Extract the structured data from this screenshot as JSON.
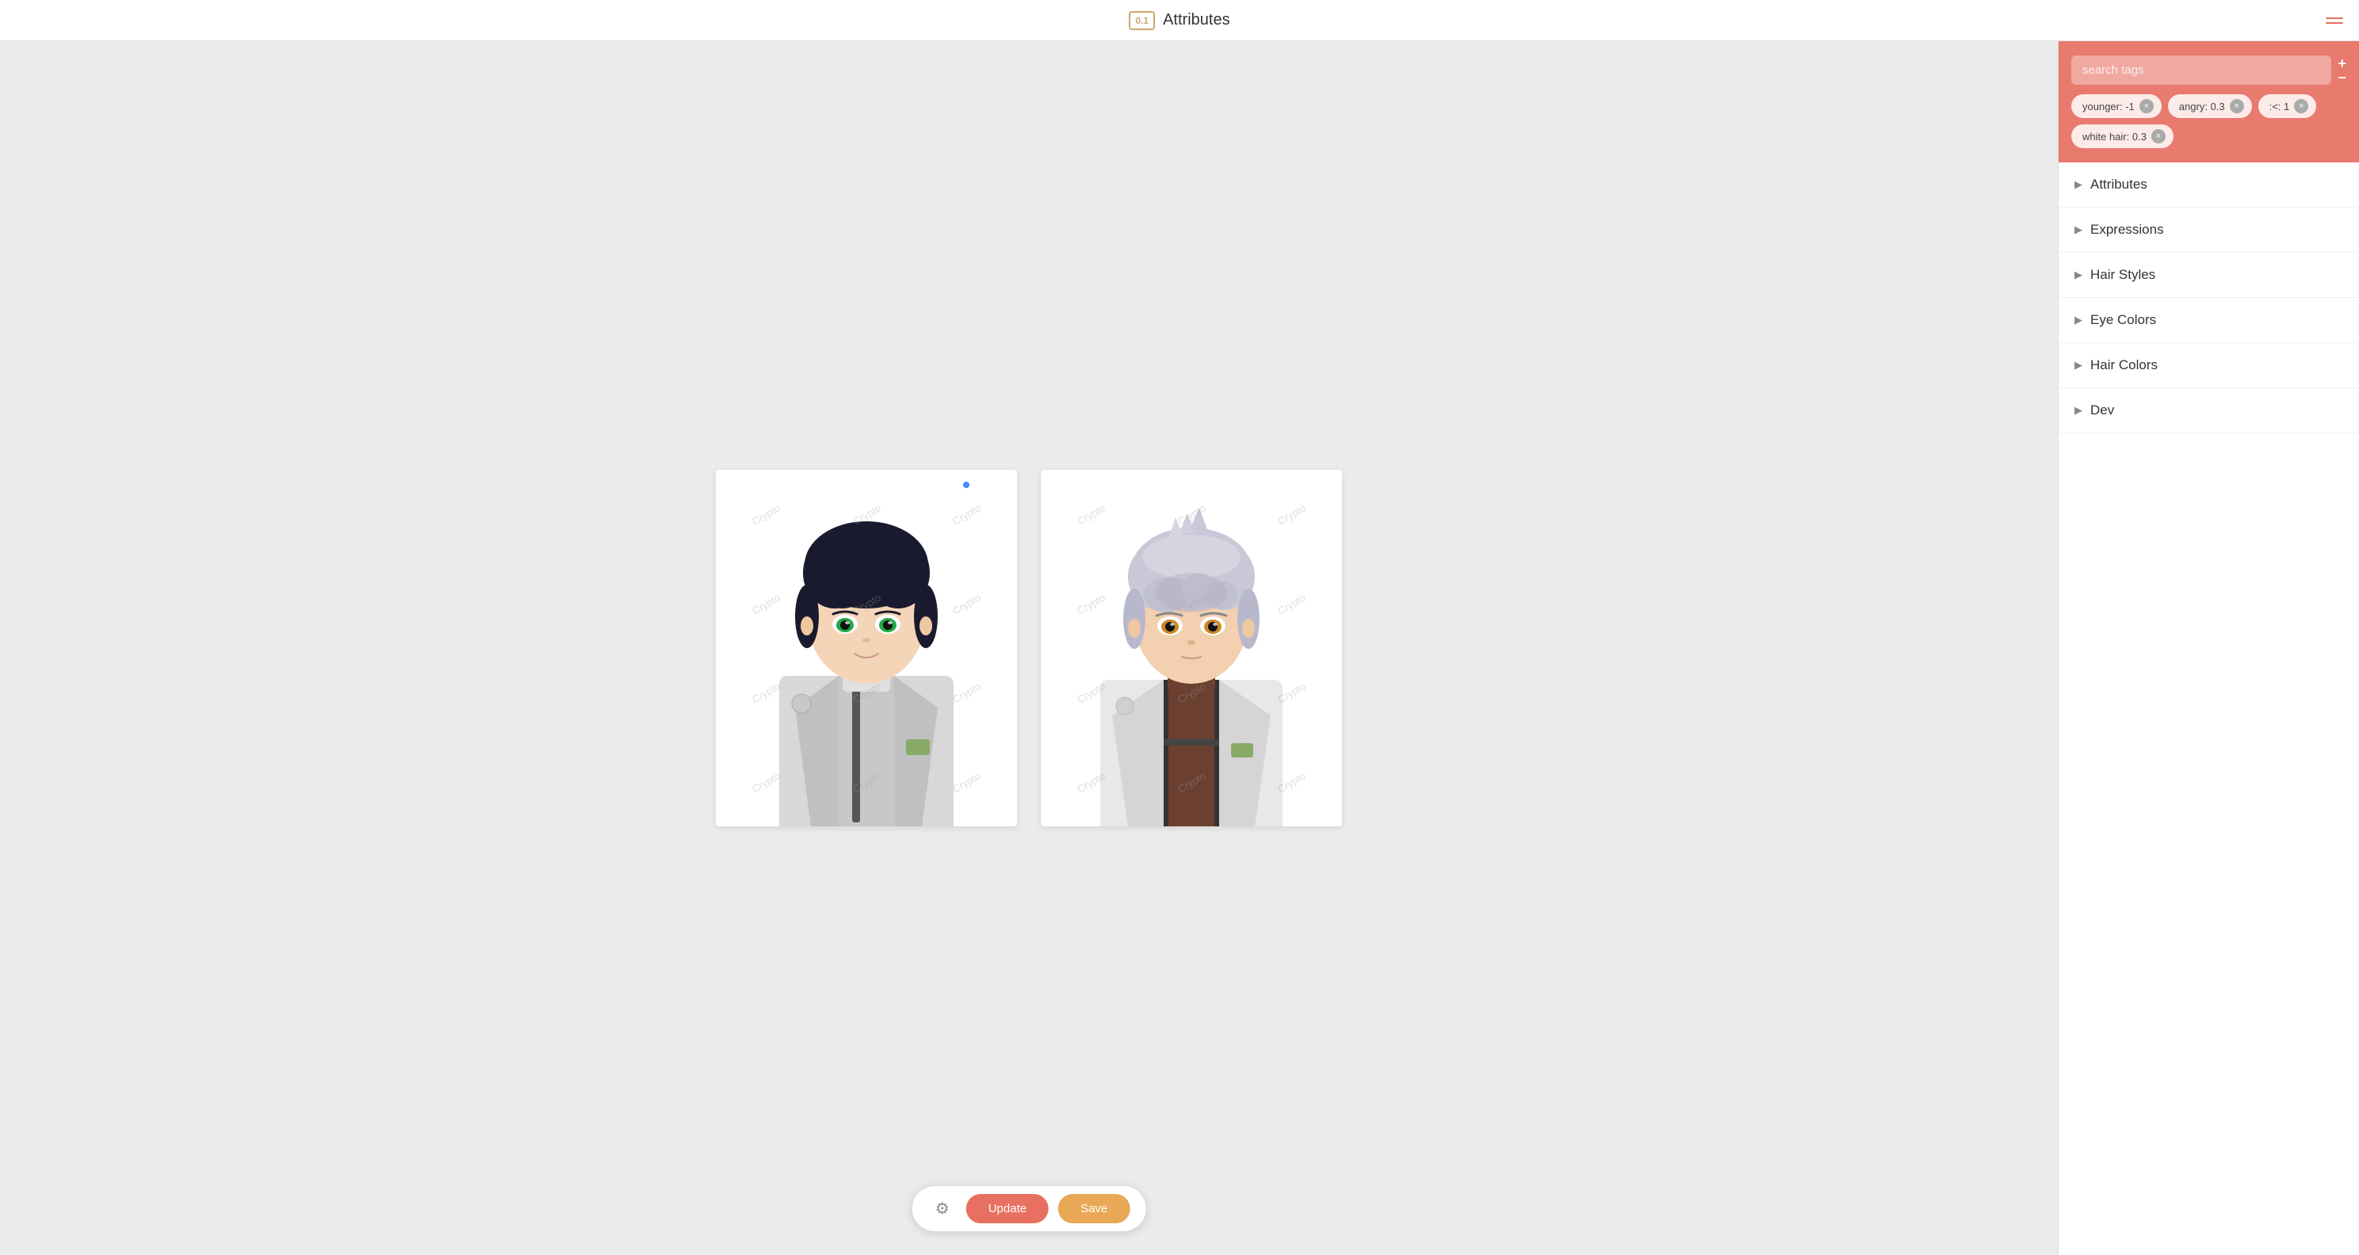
{
  "header": {
    "version": "0.1",
    "title": "Attributes",
    "menu_icon": "menu-icon"
  },
  "search": {
    "placeholder": "search tags",
    "add_remove_label": "±"
  },
  "tags": [
    {
      "id": "tag-younger",
      "label": "younger: -1"
    },
    {
      "id": "tag-angry",
      "label": "angry: 0.3"
    },
    {
      "id": "tag-emoticon",
      "label": ":<: 1"
    },
    {
      "id": "tag-white-hair",
      "label": "white hair: 0.3"
    }
  ],
  "accordion": [
    {
      "id": "acc-attributes",
      "label": "Attributes"
    },
    {
      "id": "acc-expressions",
      "label": "Expressions"
    },
    {
      "id": "acc-hair-styles",
      "label": "Hair Styles"
    },
    {
      "id": "acc-eye-colors",
      "label": "Eye Colors"
    },
    {
      "id": "acc-hair-colors",
      "label": "Hair Colors"
    },
    {
      "id": "acc-dev",
      "label": "Dev"
    }
  ],
  "toolbar": {
    "gear_label": "⚙",
    "update_label": "Update",
    "save_label": "Save"
  },
  "characters": [
    {
      "id": "char-left",
      "watermark": "Crypto"
    },
    {
      "id": "char-right",
      "watermark": "Crypto"
    }
  ],
  "watermark_text": "Crypto"
}
